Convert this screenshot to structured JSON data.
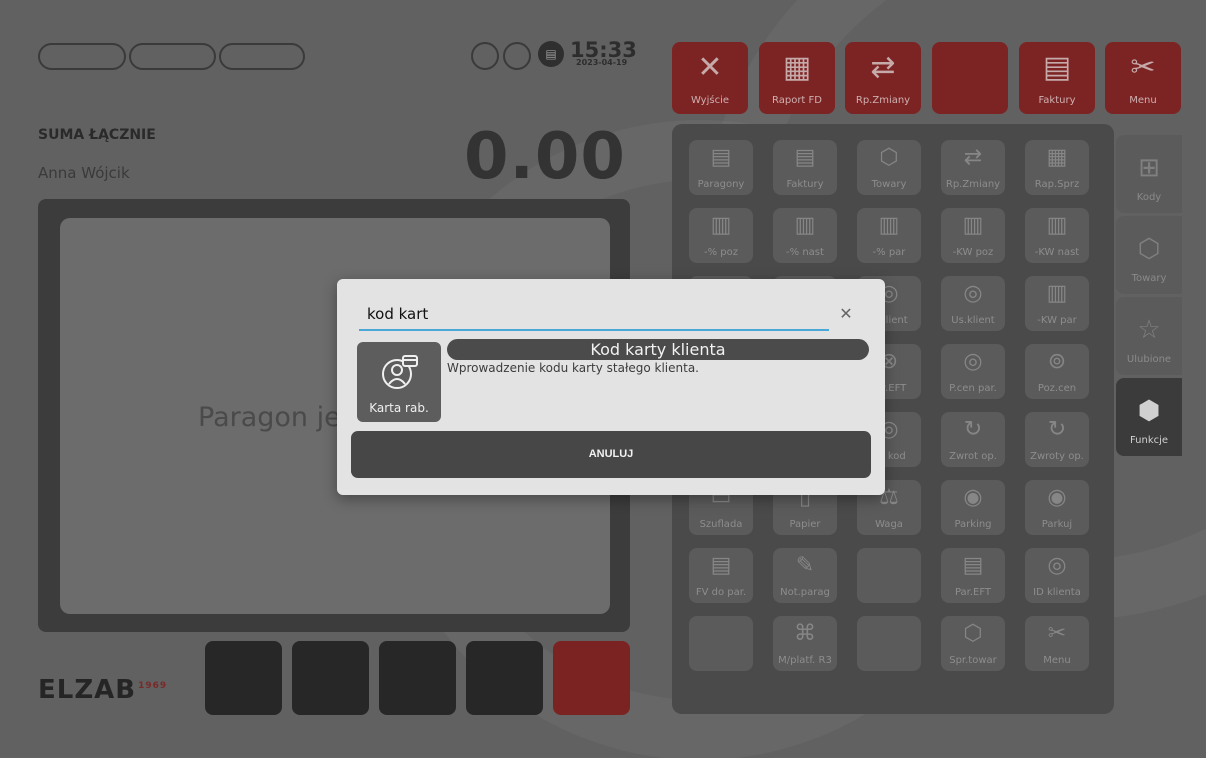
{
  "header": {
    "time": "15:33",
    "date": "2023-04-19"
  },
  "summary": {
    "sum_label": "SUMA ŁĄCZNIE",
    "cashier": "Anna Wójcik",
    "total": "0.00"
  },
  "receipt": {
    "placeholder_visible": "Paragon je"
  },
  "brand": {
    "logo": "ELZAB",
    "year": "1969"
  },
  "top_buttons": [
    {
      "label": "Wyjście",
      "icon": "close-x-icon"
    },
    {
      "label": "Raport FD",
      "icon": "clipboard-list-icon"
    },
    {
      "label": "Rp.Zmiany",
      "icon": "people-swap-icon"
    },
    {
      "label": "",
      "icon": ""
    },
    {
      "label": "Faktury",
      "icon": "invoice-search-icon"
    },
    {
      "label": "Menu",
      "icon": "tools-icon"
    }
  ],
  "grid": [
    {
      "label": "Paragony"
    },
    {
      "label": "Faktury"
    },
    {
      "label": "Towary"
    },
    {
      "label": "Rp.Zmiany"
    },
    {
      "label": "Rap.Sprz"
    },
    {
      "label": "-% poz"
    },
    {
      "label": "-% nast"
    },
    {
      "label": "-% par"
    },
    {
      "label": "-KW poz"
    },
    {
      "label": "-KW nast"
    },
    {
      "label": ""
    },
    {
      "label": ""
    },
    {
      "label": "p.klient"
    },
    {
      "label": "Us.klient"
    },
    {
      "label": "-KW par"
    },
    {
      "label": ""
    },
    {
      "label": ""
    },
    {
      "label": "ew.EFT"
    },
    {
      "label": "P.cen par."
    },
    {
      "label": "Poz.cen"
    },
    {
      "label": ""
    },
    {
      "label": ""
    },
    {
      "label": "ań kod"
    },
    {
      "label": "Zwrot op."
    },
    {
      "label": "Zwroty op."
    },
    {
      "label": "Szuflada"
    },
    {
      "label": "Papier"
    },
    {
      "label": "Waga"
    },
    {
      "label": "Parking"
    },
    {
      "label": "Parkuj"
    },
    {
      "label": "FV do par."
    },
    {
      "label": "Not.parag"
    },
    {
      "label": ""
    },
    {
      "label": "Par.EFT"
    },
    {
      "label": "ID klienta"
    },
    {
      "label": ""
    },
    {
      "label": "M/platf. R3"
    },
    {
      "label": ""
    },
    {
      "label": "Spr.towar"
    },
    {
      "label": "Menu"
    }
  ],
  "side_tabs": [
    {
      "label": "Kody"
    },
    {
      "label": "Towary"
    },
    {
      "label": "Ulubione"
    },
    {
      "label": "Funkcje"
    }
  ],
  "dialog": {
    "search_value": "kod kart",
    "result": {
      "tile_label": "Karta rab.",
      "title": "Kod karty klienta",
      "description": "Wprowadzenie kodu karty stałego klienta."
    },
    "cancel_label": "ANULUJ"
  }
}
